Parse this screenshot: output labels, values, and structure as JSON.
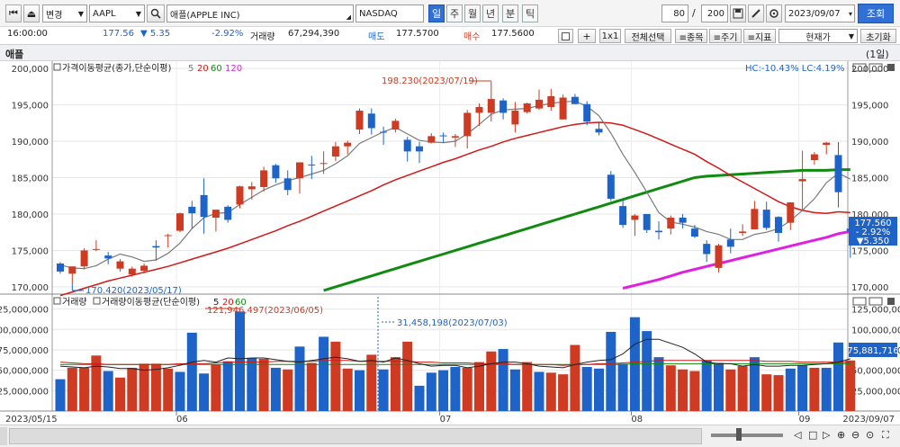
{
  "toolbar": {
    "first_btn": "⏮",
    "mode_btn": "⏏",
    "mode_select": "변경",
    "symbol": "AAPL",
    "name": "애플(APPLE INC)",
    "exchange": "NASDAQ",
    "timeframes": [
      "일",
      "주",
      "월",
      "년",
      "분",
      "틱"
    ],
    "active_timeframe": "일",
    "count": "80",
    "slash": "/",
    "total": "200",
    "date": "2023/09/07",
    "lookup": "조회"
  },
  "quote": {
    "time": "16:00:00",
    "price": "177.56",
    "change": "▼ 5.35",
    "change_pct": "-2.92%",
    "vol_label": "거래량",
    "volume": "67,294,390",
    "ask_label": "매도",
    "ask": "177.5700",
    "bid_label": "매수",
    "bid": "177.5600",
    "plus": "+",
    "ratio": "1x1",
    "select_all": "전체선택",
    "item_btn": "≡종목",
    "period_btn": "≡주기",
    "indicator_btn": "≡지표",
    "price_type": "현재가",
    "reset": "초기화"
  },
  "chart_header": {
    "name": "애플",
    "interval": "(1일)"
  },
  "price_panel": {
    "legend_label": "가격이동평균(종가,단순이평)",
    "legend_periods": [
      "5",
      "20",
      "60",
      "120"
    ],
    "hc_lc": "HC:-10.43%  LC:4.19%",
    "max_label": "198.230(2023/07/19)",
    "min_label": "170.420(2023/05/17)",
    "last_price": "177.560",
    "last_pct": "- 2.92%",
    "last_change": "▼5.350"
  },
  "volume_panel": {
    "legend_label1": "거래량",
    "legend_label2": "거래량이동평균(단순이평)",
    "legend_periods": [
      "5",
      "20",
      "60"
    ],
    "max_label": "121,946,497(2023/06/05)",
    "cursor_label": "31,458,198(2023/07/03)",
    "last_volume": "75,881,716"
  },
  "colors": {
    "up": "#cf3a22",
    "down": "#1e64c8",
    "ma5": "#7a7a7a",
    "ma20": "#d01818",
    "ma60": "#118a11",
    "ma120": "#e020e0"
  },
  "chart_data": [
    {
      "type": "candlestick",
      "title": "애플",
      "ylim": [
        169,
        201
      ],
      "y_ticks": [
        "170,000",
        "175,000",
        "180,000",
        "185,000",
        "190,000",
        "195,000",
        "200,000"
      ],
      "x_tick_labels": [
        "2023/05/15",
        "06",
        "07",
        "08",
        "09",
        "2023/09/07"
      ],
      "ohlc": [
        [
          173.2,
          173.4,
          171.8,
          172.1
        ],
        [
          171.8,
          172.8,
          170.4,
          172.8
        ],
        [
          172.8,
          175.3,
          172.4,
          175.0
        ],
        [
          175.1,
          176.4,
          174.9,
          175.2
        ],
        [
          174.3,
          174.8,
          173.1,
          173.9
        ],
        [
          172.5,
          173.8,
          172.1,
          173.5
        ],
        [
          171.7,
          172.8,
          171.4,
          172.5
        ],
        [
          172.2,
          173.2,
          171.8,
          172.9
        ],
        [
          175.6,
          176.4,
          173.6,
          175.4
        ],
        [
          177.1,
          177.3,
          175.4,
          177.1
        ],
        [
          177.7,
          180.2,
          177.5,
          180.1
        ],
        [
          181.0,
          181.8,
          178.0,
          180.1
        ],
        [
          182.6,
          184.9,
          177.3,
          179.6
        ],
        [
          179.5,
          180.6,
          177.6,
          180.6
        ],
        [
          181.0,
          181.2,
          178.8,
          179.2
        ],
        [
          181.3,
          183.9,
          180.8,
          183.8
        ],
        [
          183.4,
          184.4,
          182.0,
          183.8
        ],
        [
          183.7,
          186.5,
          183.1,
          186.0
        ],
        [
          186.7,
          186.9,
          184.3,
          184.9
        ],
        [
          184.9,
          186.0,
          182.6,
          183.3
        ],
        [
          184.9,
          187.1,
          182.8,
          187.1
        ],
        [
          186.8,
          188.0,
          184.8,
          186.7
        ],
        [
          187.0,
          188.6,
          185.5,
          187.0
        ],
        [
          187.9,
          189.9,
          187.3,
          189.3
        ],
        [
          189.3,
          190.1,
          188.2,
          189.8
        ],
        [
          191.6,
          194.5,
          191.0,
          194.2
        ],
        [
          193.8,
          194.5,
          190.9,
          191.8
        ],
        [
          191.3,
          192.0,
          189.5,
          191.2
        ],
        [
          191.6,
          193.1,
          191.2,
          192.8
        ],
        [
          190.2,
          190.6,
          187.2,
          188.6
        ],
        [
          189.3,
          189.9,
          187.0,
          188.6
        ],
        [
          189.8,
          191.1,
          189.7,
          190.7
        ],
        [
          190.8,
          191.2,
          189.8,
          190.7
        ],
        [
          190.5,
          191.0,
          189.2,
          190.7
        ],
        [
          190.7,
          194.3,
          189.0,
          193.9
        ],
        [
          193.9,
          195.2,
          192.1,
          194.7
        ],
        [
          193.9,
          198.2,
          192.7,
          195.8
        ],
        [
          195.6,
          195.9,
          193.0,
          193.9
        ],
        [
          192.3,
          195.4,
          191.2,
          194.2
        ],
        [
          194.0,
          195.3,
          193.8,
          195.2
        ],
        [
          194.5,
          197.1,
          194.3,
          195.7
        ],
        [
          194.7,
          197.2,
          194.2,
          196.2
        ],
        [
          193.0,
          196.4,
          193.0,
          196.0
        ],
        [
          196.1,
          196.5,
          195.1,
          195.1
        ],
        [
          195.1,
          195.5,
          192.2,
          192.7
        ],
        [
          191.7,
          192.5,
          190.8,
          191.2
        ],
        [
          185.4,
          185.9,
          181.8,
          182.1
        ],
        [
          181.1,
          182.0,
          178.1,
          178.5
        ],
        [
          179.2,
          180.0,
          177.0,
          179.8
        ],
        [
          180.0,
          180.0,
          177.4,
          177.8
        ],
        [
          177.7,
          179.0,
          176.5,
          177.5
        ],
        [
          178.0,
          179.8,
          177.2,
          179.5
        ],
        [
          179.5,
          180.0,
          178.0,
          178.8
        ],
        [
          178.0,
          178.5,
          176.7,
          176.9
        ],
        [
          175.9,
          176.4,
          173.4,
          174.5
        ],
        [
          172.6,
          175.9,
          172.0,
          175.7
        ],
        [
          176.5,
          178.0,
          174.6,
          175.5
        ],
        [
          177.4,
          178.6,
          177.0,
          177.6
        ],
        [
          177.9,
          181.8,
          177.9,
          180.7
        ],
        [
          180.6,
          181.7,
          177.8,
          178.1
        ],
        [
          179.6,
          179.7,
          176.2,
          177.4
        ],
        [
          178.8,
          181.6,
          177.8,
          181.6
        ],
        [
          184.5,
          188.7,
          180.6,
          184.8
        ],
        [
          187.4,
          188.5,
          186.8,
          188.2
        ],
        [
          189.5,
          189.9,
          188.2,
          189.8
        ],
        [
          188.1,
          189.9,
          180.9,
          183.0
        ],
        [
          178.0,
          178.2,
          174.0,
          177.6
        ]
      ],
      "ma5": [
        173.0,
        172.6,
        172.5,
        172.9,
        173.8,
        174.5,
        174.1,
        173.5,
        173.7,
        174.6,
        176.0,
        178.0,
        179.5,
        180.1,
        180.2,
        181.3,
        182.3,
        183.3,
        184.0,
        184.6,
        185.0,
        185.5,
        186.0,
        186.9,
        188.0,
        189.7,
        190.5,
        191.3,
        191.9,
        191.0,
        190.1,
        189.9,
        189.8,
        190.0,
        191.0,
        192.3,
        193.7,
        194.3,
        194.4,
        194.5,
        194.9,
        195.2,
        195.4,
        195.5,
        194.8,
        193.5,
        191.1,
        188.2,
        185.7,
        183.0,
        180.2,
        178.9,
        178.6,
        178.2,
        177.6,
        177.2,
        176.5,
        176.5,
        177.2,
        177.5,
        178.0,
        179.1,
        180.5,
        182.1,
        184.3,
        185.6,
        184.8
      ],
      "ma20": [
        168.8,
        169.3,
        169.8,
        170.3,
        170.8,
        171.2,
        171.6,
        172.0,
        172.4,
        172.8,
        173.3,
        173.8,
        174.3,
        174.8,
        175.3,
        175.9,
        176.5,
        177.1,
        177.7,
        178.4,
        179.0,
        179.7,
        180.4,
        181.1,
        181.8,
        182.5,
        183.2,
        184.0,
        184.7,
        185.3,
        185.9,
        186.5,
        187.1,
        187.6,
        188.2,
        188.8,
        189.3,
        189.9,
        190.4,
        190.8,
        191.2,
        191.6,
        192.0,
        192.3,
        192.5,
        192.6,
        192.5,
        192.2,
        191.6,
        191.0,
        190.3,
        189.6,
        188.9,
        188.2,
        187.2,
        186.3,
        185.3,
        184.4,
        183.5,
        182.6,
        181.7,
        181.0,
        180.5,
        180.2,
        180.1,
        180.3,
        180.2
      ],
      "ma60": [
        null,
        null,
        null,
        null,
        null,
        null,
        null,
        null,
        null,
        null,
        null,
        null,
        null,
        null,
        null,
        null,
        null,
        null,
        null,
        null,
        null,
        null,
        169.5,
        170.0,
        170.5,
        171.0,
        171.5,
        172.0,
        172.5,
        173.0,
        173.5,
        174.0,
        174.5,
        175.0,
        175.5,
        176.0,
        176.5,
        177.0,
        177.5,
        178.0,
        178.5,
        179.0,
        179.5,
        180.0,
        180.5,
        181.0,
        181.5,
        182.0,
        182.5,
        183.0,
        183.5,
        184.0,
        184.5,
        185.0,
        185.2,
        185.3,
        185.4,
        185.5,
        185.6,
        185.7,
        185.8,
        185.9,
        186.0,
        186.0,
        186.0,
        186.1,
        186.1
      ],
      "ma120": [
        null,
        null,
        null,
        null,
        null,
        null,
        null,
        null,
        null,
        null,
        null,
        null,
        null,
        null,
        null,
        null,
        null,
        null,
        null,
        null,
        null,
        null,
        null,
        null,
        null,
        null,
        null,
        null,
        null,
        null,
        null,
        null,
        null,
        null,
        null,
        null,
        null,
        null,
        null,
        null,
        null,
        null,
        null,
        null,
        null,
        null,
        null,
        169.8,
        170.2,
        170.6,
        171.0,
        171.5,
        172.0,
        172.4,
        172.8,
        173.2,
        173.6,
        174.0,
        174.4,
        174.8,
        175.2,
        175.6,
        176.0,
        176.4,
        176.8,
        177.3,
        177.6
      ]
    },
    {
      "type": "bar",
      "title": "거래량",
      "ylim": [
        0,
        140000000
      ],
      "y_ticks": [
        "25,000,000",
        "50,000,000",
        "75,000,000",
        "100,000,000",
        "125,000,000"
      ],
      "values": [
        39,
        53,
        53,
        68,
        49,
        41,
        53,
        58,
        58,
        52,
        48,
        96,
        46,
        57,
        61,
        122,
        65,
        64,
        53,
        51,
        79,
        59,
        91,
        85,
        52,
        50,
        69,
        51,
        66,
        85,
        31,
        47,
        50,
        54,
        53,
        60,
        73,
        76,
        51,
        60,
        48,
        47,
        45,
        81,
        54,
        52,
        97,
        58,
        115,
        98,
        66,
        56,
        51,
        49,
        62,
        59,
        51,
        55,
        66,
        45,
        44,
        52,
        56,
        53,
        53,
        84,
        62
      ],
      "values_unit": "millions",
      "directions": [
        "d",
        "u",
        "u",
        "u",
        "d",
        "u",
        "u",
        "u",
        "u",
        "u",
        "d",
        "d",
        "d",
        "u",
        "d",
        "d",
        "d",
        "u",
        "d",
        "u",
        "d",
        "u",
        "d",
        "u",
        "u",
        "d",
        "u",
        "d",
        "u",
        "u",
        "d",
        "d",
        "d",
        "d",
        "u",
        "u",
        "u",
        "d",
        "d",
        "u",
        "d",
        "u",
        "u",
        "u",
        "d",
        "d",
        "d",
        "d",
        "d",
        "d",
        "d",
        "u",
        "u",
        "u",
        "d",
        "d",
        "u",
        "u",
        "d",
        "u",
        "u",
        "d",
        "d",
        "u",
        "d",
        "d",
        "u"
      ],
      "ma5": [
        55,
        54,
        53,
        55,
        54,
        52,
        52,
        50,
        51,
        53,
        56,
        60,
        62,
        60,
        65,
        64,
        65,
        65,
        63,
        61,
        60,
        62,
        64,
        66,
        64,
        61,
        62,
        60,
        65,
        62,
        58,
        55,
        56,
        56,
        53,
        55,
        58,
        60,
        60,
        58,
        55,
        54,
        53,
        57,
        60,
        62,
        63,
        70,
        82,
        88,
        88,
        83,
        78,
        70,
        60,
        58,
        58,
        55,
        57,
        55,
        55,
        56,
        56,
        57,
        58,
        60,
        64
      ],
      "ma20": [
        60,
        59,
        58,
        58,
        57,
        57,
        57,
        57,
        57,
        57,
        58,
        58,
        58,
        59,
        60,
        60,
        60,
        60,
        61,
        61,
        61,
        61,
        62,
        62,
        62,
        61,
        61,
        61,
        61,
        61,
        60,
        60,
        59,
        59,
        59,
        58,
        58,
        58,
        57,
        57,
        57,
        57,
        56,
        57,
        57,
        58,
        58,
        59,
        60,
        61,
        62,
        62,
        62,
        62,
        62,
        62,
        62,
        62,
        62,
        61,
        61,
        61,
        60,
        60,
        60,
        60,
        60
      ],
      "ma60": [
        57,
        57,
        57,
        57,
        57,
        57,
        57,
        57,
        57,
        57,
        57,
        57,
        57,
        57,
        57,
        57,
        57,
        57,
        57,
        57,
        57,
        57,
        57,
        57,
        57,
        57,
        57,
        57,
        57,
        57,
        57,
        57,
        57,
        57,
        57,
        57,
        57,
        57,
        57,
        57,
        57,
        57,
        57,
        57,
        57,
        57,
        57,
        57,
        58,
        58,
        58,
        58,
        58,
        58,
        58,
        58,
        58,
        58,
        58,
        58,
        58,
        58,
        58,
        58,
        58,
        58,
        58
      ]
    }
  ]
}
